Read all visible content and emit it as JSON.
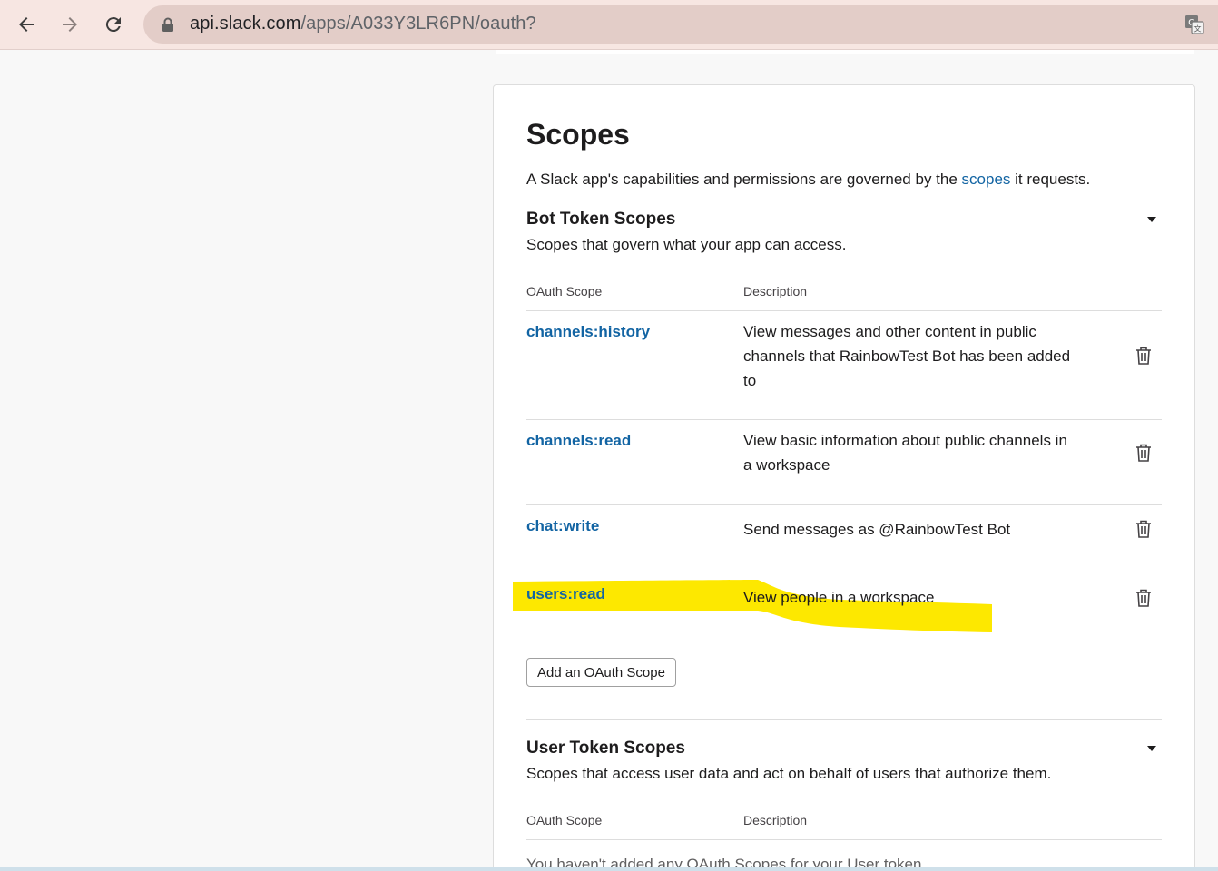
{
  "browser": {
    "url_host": "api.slack.com",
    "url_path": "/apps/A033Y3LR6PN/oauth?",
    "icons": [
      "back-arrow-icon",
      "forward-arrow-icon",
      "reload-icon",
      "lock-icon",
      "translate-icon"
    ]
  },
  "card": {
    "title": "Scopes",
    "desc_before": "A Slack app's capabilities and permissions are governed by the ",
    "desc_link": "scopes",
    "desc_after": " it requests."
  },
  "bot_section": {
    "title": "Bot Token Scopes",
    "subtitle": "Scopes that govern what your app can access.",
    "col_scope": "OAuth Scope",
    "col_description": "Description",
    "rows": [
      {
        "scope": "channels:history",
        "description": "View messages and other content in public channels that RainbowTest Bot has been added to"
      },
      {
        "scope": "channels:read",
        "description": "View basic information about public channels in a workspace"
      },
      {
        "scope": "chat:write",
        "description": "Send messages as @RainbowTest Bot"
      },
      {
        "scope": "users:read",
        "description": "View people in a workspace"
      }
    ],
    "add_button": "Add an OAuth Scope"
  },
  "user_section": {
    "title": "User Token Scopes",
    "subtitle": "Scopes that access user data and act on behalf of users that authorize them.",
    "col_scope": "OAuth Scope",
    "col_description": "Description",
    "empty_note": "You haven't added any OAuth Scopes for your User token"
  },
  "colors": {
    "link": "#1264a3",
    "highlight": "#fde800",
    "toolbar": "#f7e6e2"
  }
}
